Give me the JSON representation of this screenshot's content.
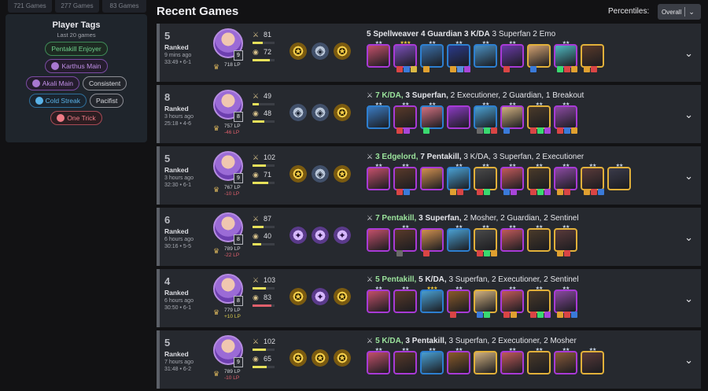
{
  "top_stats": [
    "721 Games",
    "277 Games",
    "83 Games"
  ],
  "player_tags": {
    "title": "Player Tags",
    "subtitle": "Last 20 games",
    "rows": [
      [
        {
          "label": "Pentakill Enjoyer",
          "style": "green",
          "icon": "none"
        }
      ],
      [
        {
          "label": "Karthus Main",
          "style": "purple",
          "icon": "champion-portrait"
        }
      ],
      [
        {
          "label": "Akali Main",
          "style": "purple",
          "icon": "champion-portrait"
        },
        {
          "label": "Consistent",
          "style": "grey",
          "icon": "none"
        }
      ],
      [
        {
          "label": "Cold Streak",
          "style": "blue",
          "icon": "drop-icon"
        },
        {
          "label": "Pacifist",
          "style": "grey",
          "icon": "none"
        }
      ],
      [
        {
          "label": "One Trick",
          "style": "red",
          "icon": "hand-icon"
        }
      ]
    ]
  },
  "header": {
    "title": "Recent Games",
    "percentiles_label": "Percentiles:",
    "percentiles_value": "Overall"
  },
  "games": [
    {
      "place": "5",
      "mode": "Ranked",
      "ago": "9 mins ago",
      "duration": "33:49 • 6-1",
      "level": "9",
      "lp": "718 LP",
      "lp_delta": "",
      "delta_sign": "none",
      "damage": "81",
      "gold": "72",
      "damage_pct": 0.45,
      "gold_pct": 0.8,
      "augments": [
        "gold",
        "silver",
        "gold"
      ],
      "trait_icon": "none",
      "traits": [
        {
          "text": "5 Spellweaver",
          "bold": true,
          "hl": false
        },
        {
          "text": "4 Guardian",
          "bold": true,
          "hl": false
        },
        {
          "text": "3 K/DA",
          "bold": true,
          "hl": false
        },
        {
          "text": "3 Superfan",
          "bold": false,
          "hl": false
        },
        {
          "text": "2 Emo",
          "bold": false,
          "hl": false
        }
      ],
      "units": [
        {
          "tier": 4,
          "stars": 2,
          "color": "#c2506a",
          "items": []
        },
        {
          "tier": 4,
          "stars": 3,
          "color": "#7a4fb8",
          "items": [
            "#d94545",
            "#3a7ad9",
            "#d9b845"
          ]
        },
        {
          "tier": 3,
          "stars": 2,
          "color": "#3a6fa8",
          "items": [
            "#e0a030"
          ]
        },
        {
          "tier": 3,
          "stars": 2,
          "color": "#2a3a8a",
          "items": [
            "#e0a030",
            "#5a8fd9",
            "#a845d9"
          ]
        },
        {
          "tier": 3,
          "stars": 2,
          "color": "#4a8fc0",
          "items": []
        },
        {
          "tier": 4,
          "stars": 2,
          "color": "#6a3aa8",
          "items": [
            "#d94545"
          ]
        },
        {
          "tier": 5,
          "stars": 1,
          "color": "#d0a070",
          "items": [
            "#3a7ad9"
          ]
        },
        {
          "tier": 4,
          "stars": 2,
          "color": "#4fb8c0",
          "items": [
            "#3ad970",
            "#d94545",
            "#e0a030"
          ]
        },
        {
          "tier": 5,
          "stars": 1,
          "color": "#5a3a2a",
          "items": [
            "#e0a030",
            "#d94545"
          ]
        }
      ]
    },
    {
      "place": "8",
      "mode": "Ranked",
      "ago": "3 hours ago",
      "duration": "25:18 • 4-6",
      "level": "8",
      "lp": "757 LP",
      "lp_delta": "-46 LP",
      "delta_sign": "neg",
      "damage": "49",
      "gold": "48",
      "damage_pct": 0.3,
      "gold_pct": 0.55,
      "augments": [
        "silver",
        "silver",
        "gold"
      ],
      "trait_icon": "sword",
      "traits": [
        {
          "text": "7 K/DA,",
          "bold": true,
          "hl": true
        },
        {
          "text": "3 Superfan,",
          "bold": true,
          "hl": false
        },
        {
          "text": "2 Executioner,",
          "bold": false,
          "hl": false
        },
        {
          "text": "2 Guardian,",
          "bold": false,
          "hl": false
        },
        {
          "text": "1 Breakout",
          "bold": false,
          "hl": false
        }
      ],
      "units": [
        {
          "tier": 3,
          "stars": 2,
          "color": "#3a7ac0",
          "items": []
        },
        {
          "tier": 4,
          "stars": 2,
          "color": "#5a3a2a",
          "items": [
            "#d94545",
            "#a845d9"
          ]
        },
        {
          "tier": 3,
          "stars": 2,
          "color": "#d07080",
          "items": [
            "#3ad970"
          ]
        },
        {
          "tier": 4,
          "stars": 1,
          "color": "#8a3ac0",
          "items": []
        },
        {
          "tier": 3,
          "stars": 2,
          "color": "#4a9fd0",
          "items": [
            "#6a6a6a",
            "#3ad970",
            "#d94545"
          ]
        },
        {
          "tier": 4,
          "stars": 2,
          "color": "#d0b080",
          "items": [
            "#3a7ad9"
          ]
        },
        {
          "tier": 5,
          "stars": 2,
          "color": "#4a3a2a",
          "items": [
            "#d94545",
            "#3ad970",
            "#a845d9"
          ]
        },
        {
          "tier": 4,
          "stars": 2,
          "color": "#8a4aa0",
          "items": [
            "#d94545",
            "#3a7ad9",
            "#e0a030"
          ]
        }
      ]
    },
    {
      "place": "5",
      "mode": "Ranked",
      "ago": "3 hours ago",
      "duration": "32:30 • 6-1",
      "level": "9",
      "lp": "767 LP",
      "lp_delta": "-10 LP",
      "delta_sign": "neg",
      "damage": "102",
      "gold": "71",
      "damage_pct": 0.6,
      "gold_pct": 0.7,
      "augments": [
        "gold",
        "silver",
        "gold"
      ],
      "trait_icon": "swords",
      "traits": [
        {
          "text": "3 Edgelord,",
          "bold": true,
          "hl": true
        },
        {
          "text": "7 Pentakill,",
          "bold": true,
          "hl": false
        },
        {
          "text": "3 K/DA,",
          "bold": false,
          "hl": false
        },
        {
          "text": "3 Superfan,",
          "bold": false,
          "hl": false
        },
        {
          "text": "2 Executioner",
          "bold": false,
          "hl": false
        }
      ],
      "units": [
        {
          "tier": 4,
          "stars": 2,
          "color": "#c2506a",
          "items": []
        },
        {
          "tier": 4,
          "stars": 2,
          "color": "#5a3a2a",
          "items": [
            "#d94545",
            "#3a7ad9"
          ]
        },
        {
          "tier": 4,
          "stars": 1,
          "color": "#d09050",
          "items": []
        },
        {
          "tier": 3,
          "stars": 2,
          "color": "#4a9fd0",
          "items": [
            "#e0a030",
            "#d94545"
          ]
        },
        {
          "tier": 5,
          "stars": 2,
          "color": "#4a4a4a",
          "items": [
            "#d94545",
            "#3ad970"
          ]
        },
        {
          "tier": 4,
          "stars": 2,
          "color": "#c05a5a",
          "items": [
            "#3a7ad9",
            "#a845d9"
          ]
        },
        {
          "tier": 5,
          "stars": 2,
          "color": "#4a3a2a",
          "items": [
            "#d94545",
            "#3ad970",
            "#a845d9"
          ]
        },
        {
          "tier": 4,
          "stars": 2,
          "color": "#8a4aa0",
          "items": [
            "#e0a030",
            "#d94545"
          ]
        },
        {
          "tier": 5,
          "stars": 2,
          "color": "#5a3a3a",
          "items": [
            "#e0a030",
            "#d94545",
            "#3a7ad9"
          ]
        },
        {
          "tier": 5,
          "stars": 2,
          "color": "#3a3a4a",
          "items": []
        }
      ]
    },
    {
      "place": "6",
      "mode": "Ranked",
      "ago": "6 hours ago",
      "duration": "30:16 • 5-5",
      "level": "8",
      "lp": "789 LP",
      "lp_delta": "-22 LP",
      "delta_sign": "neg",
      "damage": "87",
      "gold": "40",
      "damage_pct": 0.5,
      "gold_pct": 0.4,
      "augments": [
        "prism",
        "prism",
        "prism"
      ],
      "trait_icon": "swords",
      "traits": [
        {
          "text": "7 Pentakill,",
          "bold": true,
          "hl": true
        },
        {
          "text": "3 Superfan,",
          "bold": true,
          "hl": false
        },
        {
          "text": "2 Mosher,",
          "bold": false,
          "hl": false
        },
        {
          "text": "2 Guardian,",
          "bold": false,
          "hl": false
        },
        {
          "text": "2 Sentinel",
          "bold": false,
          "hl": false
        }
      ],
      "units": [
        {
          "tier": 4,
          "stars": 1,
          "color": "#c2506a",
          "items": []
        },
        {
          "tier": 4,
          "stars": 2,
          "color": "#5a3a2a",
          "items": [
            "#6a6a6a"
          ]
        },
        {
          "tier": 4,
          "stars": 1,
          "color": "#d09050",
          "items": [
            "#d94545"
          ]
        },
        {
          "tier": 3,
          "stars": 2,
          "color": "#4a9fd0",
          "items": []
        },
        {
          "tier": 5,
          "stars": 2,
          "color": "#4a4a4a",
          "items": [
            "#d94545",
            "#3ad970",
            "#e0a030"
          ]
        },
        {
          "tier": 4,
          "stars": 2,
          "color": "#c05a5a",
          "items": []
        },
        {
          "tier": 5,
          "stars": 2,
          "color": "#4a3a2a",
          "items": []
        },
        {
          "tier": 5,
          "stars": 2,
          "color": "#5a3a3a",
          "items": [
            "#e0a030",
            "#d94545"
          ]
        }
      ]
    },
    {
      "place": "4",
      "mode": "Ranked",
      "ago": "6 hours ago",
      "duration": "30:50 • 6-1",
      "level": "8",
      "lp": "779 LP",
      "lp_delta": "+10 LP",
      "delta_sign": "pos",
      "damage": "103",
      "gold": "83",
      "damage_pct": 0.62,
      "gold_pct": 0.85,
      "augments": [
        "gold",
        "prism",
        "gold"
      ],
      "trait_icon": "swords",
      "traits": [
        {
          "text": "5 Pentakill,",
          "bold": true,
          "hl": true
        },
        {
          "text": "5 K/DA,",
          "bold": true,
          "hl": false
        },
        {
          "text": "3 Superfan,",
          "bold": false,
          "hl": false
        },
        {
          "text": "2 Executioner,",
          "bold": false,
          "hl": false
        },
        {
          "text": "2 Sentinel",
          "bold": false,
          "hl": false
        }
      ],
      "units": [
        {
          "tier": 4,
          "stars": 2,
          "color": "#c2506a",
          "items": []
        },
        {
          "tier": 4,
          "stars": 2,
          "color": "#5a3a2a",
          "items": []
        },
        {
          "tier": 3,
          "stars": 3,
          "color": "#4a9fd0",
          "items": []
        },
        {
          "tier": 4,
          "stars": 2,
          "color": "#8a5a2a",
          "items": [
            "#d94545"
          ]
        },
        {
          "tier": 5,
          "stars": 1,
          "color": "#d0b080",
          "items": [
            "#3a7ad9",
            "#3ad970"
          ]
        },
        {
          "tier": 4,
          "stars": 2,
          "color": "#c05a5a",
          "items": [
            "#d94545",
            "#e0a030"
          ]
        },
        {
          "tier": 5,
          "stars": 2,
          "color": "#4a3a2a",
          "items": [
            "#d94545",
            "#3ad970",
            "#a845d9"
          ]
        },
        {
          "tier": 4,
          "stars": 2,
          "color": "#8a4aa0",
          "items": [
            "#e0a030",
            "#d94545",
            "#3a7ad9"
          ]
        }
      ]
    },
    {
      "place": "5",
      "mode": "Ranked",
      "ago": "7 hours ago",
      "duration": "31:48 • 6-2",
      "level": "9",
      "lp": "789 LP",
      "lp_delta": "-10 LP",
      "delta_sign": "neg",
      "damage": "102",
      "gold": "65",
      "damage_pct": 0.6,
      "gold_pct": 0.65,
      "augments": [
        "gold",
        "gold",
        "gold"
      ],
      "trait_icon": "sword",
      "traits": [
        {
          "text": "5 K/DA,",
          "bold": true,
          "hl": true
        },
        {
          "text": "3 Pentakill,",
          "bold": true,
          "hl": false
        },
        {
          "text": "3 Superfan,",
          "bold": false,
          "hl": false
        },
        {
          "text": "2 Executioner,",
          "bold": false,
          "hl": false
        },
        {
          "text": "2 Mosher",
          "bold": false,
          "hl": false
        }
      ],
      "units": [
        {
          "tier": 4,
          "stars": 2,
          "color": "#c2506a",
          "items": []
        },
        {
          "tier": 4,
          "stars": 2,
          "color": "#5a3a2a",
          "items": []
        },
        {
          "tier": 3,
          "stars": 2,
          "color": "#4a9fd0",
          "items": []
        },
        {
          "tier": 4,
          "stars": 2,
          "color": "#8a5a2a",
          "items": []
        },
        {
          "tier": 5,
          "stars": 1,
          "color": "#d0b080",
          "items": []
        },
        {
          "tier": 4,
          "stars": 2,
          "color": "#c05a5a",
          "items": []
        },
        {
          "tier": 5,
          "stars": 2,
          "color": "#4a3a2a",
          "items": []
        },
        {
          "tier": 4,
          "stars": 2,
          "color": "#8a5a3a",
          "items": []
        },
        {
          "tier": 5,
          "stars": 2,
          "color": "#5a3a3a",
          "items": []
        }
      ]
    }
  ]
}
